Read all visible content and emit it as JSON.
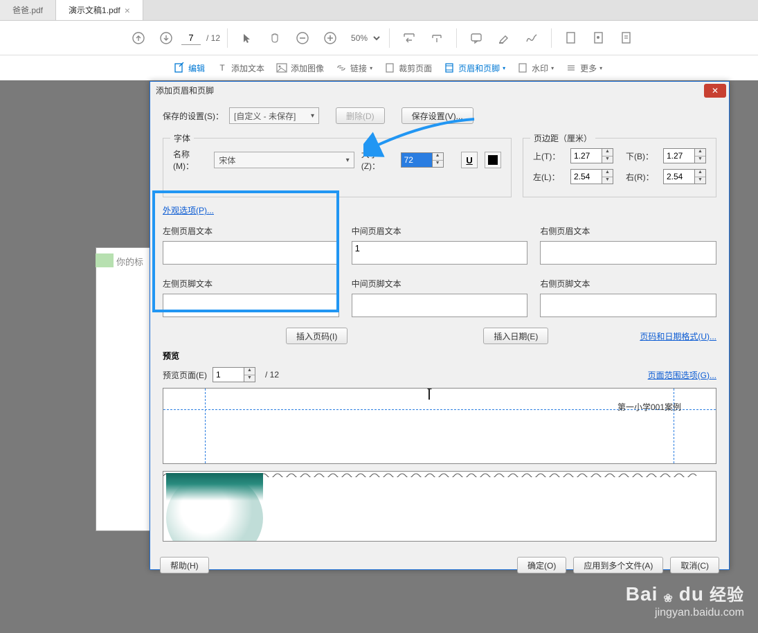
{
  "tabs": [
    {
      "label": "爸爸.pdf",
      "active": false
    },
    {
      "label": "演示文稿1.pdf",
      "active": true
    }
  ],
  "toolbar": {
    "page_current": "7",
    "page_total": "/ 12",
    "zoom": "50%"
  },
  "sec_toolbar": {
    "edit": "编辑",
    "add_text": "添加文本",
    "add_image": "添加图像",
    "link": "链接",
    "crop": "裁剪页面",
    "header_footer": "页眉和页脚",
    "watermark": "水印",
    "more": "更多"
  },
  "doc_text": "你的标",
  "dialog": {
    "title": "添加页眉和页脚",
    "saved_settings_label": "保存的设置(S)：",
    "saved_settings_value": "[自定义 - 未保存]",
    "delete_btn": "删除(D)",
    "save_settings_btn": "保存设置(V)...",
    "font_section": "字体",
    "font_name_label": "名称(M)：",
    "font_name_value": "宋体",
    "font_size_label": "大小(Z)：",
    "font_size_value": "72",
    "margins_section": "页边距（厘米）",
    "margin_top_label": "上(T)：",
    "margin_top_value": "1.27",
    "margin_bottom_label": "下(B)：",
    "margin_bottom_value": "1.27",
    "margin_left_label": "左(L)：",
    "margin_left_value": "2.54",
    "margin_right_label": "右(R)：",
    "margin_right_value": "2.54",
    "appearance_link": "外观选项(P)...",
    "header": {
      "left_label": "左侧页眉文本",
      "left_value": "",
      "center_label": "中间页眉文本",
      "center_value": "1",
      "right_label": "右侧页眉文本",
      "right_value": ""
    },
    "footer": {
      "left_label": "左侧页脚文本",
      "center_label": "中间页脚文本",
      "right_label": "右侧页脚文本"
    },
    "insert_page_btn": "插入页码(I)",
    "insert_date_btn": "插入日期(E)",
    "page_date_format_link": "页码和日期格式(U)...",
    "preview_section": "预览",
    "preview_page_label": "预览页面(E)",
    "preview_page_value": "1",
    "preview_total": "/ 12",
    "page_range_link": "页面范围选项(G)...",
    "preview_text": "第一小学001案例",
    "help_btn": "帮助(H)",
    "ok_btn": "确定(O)",
    "apply_multi_btn": "应用到多个文件(A)",
    "cancel_btn": "取消(C)"
  },
  "watermark": {
    "brand": "Bai",
    "brand2": "du",
    "paw": "❀",
    "cn": "经验",
    "url": "jingyan.baidu.com"
  }
}
